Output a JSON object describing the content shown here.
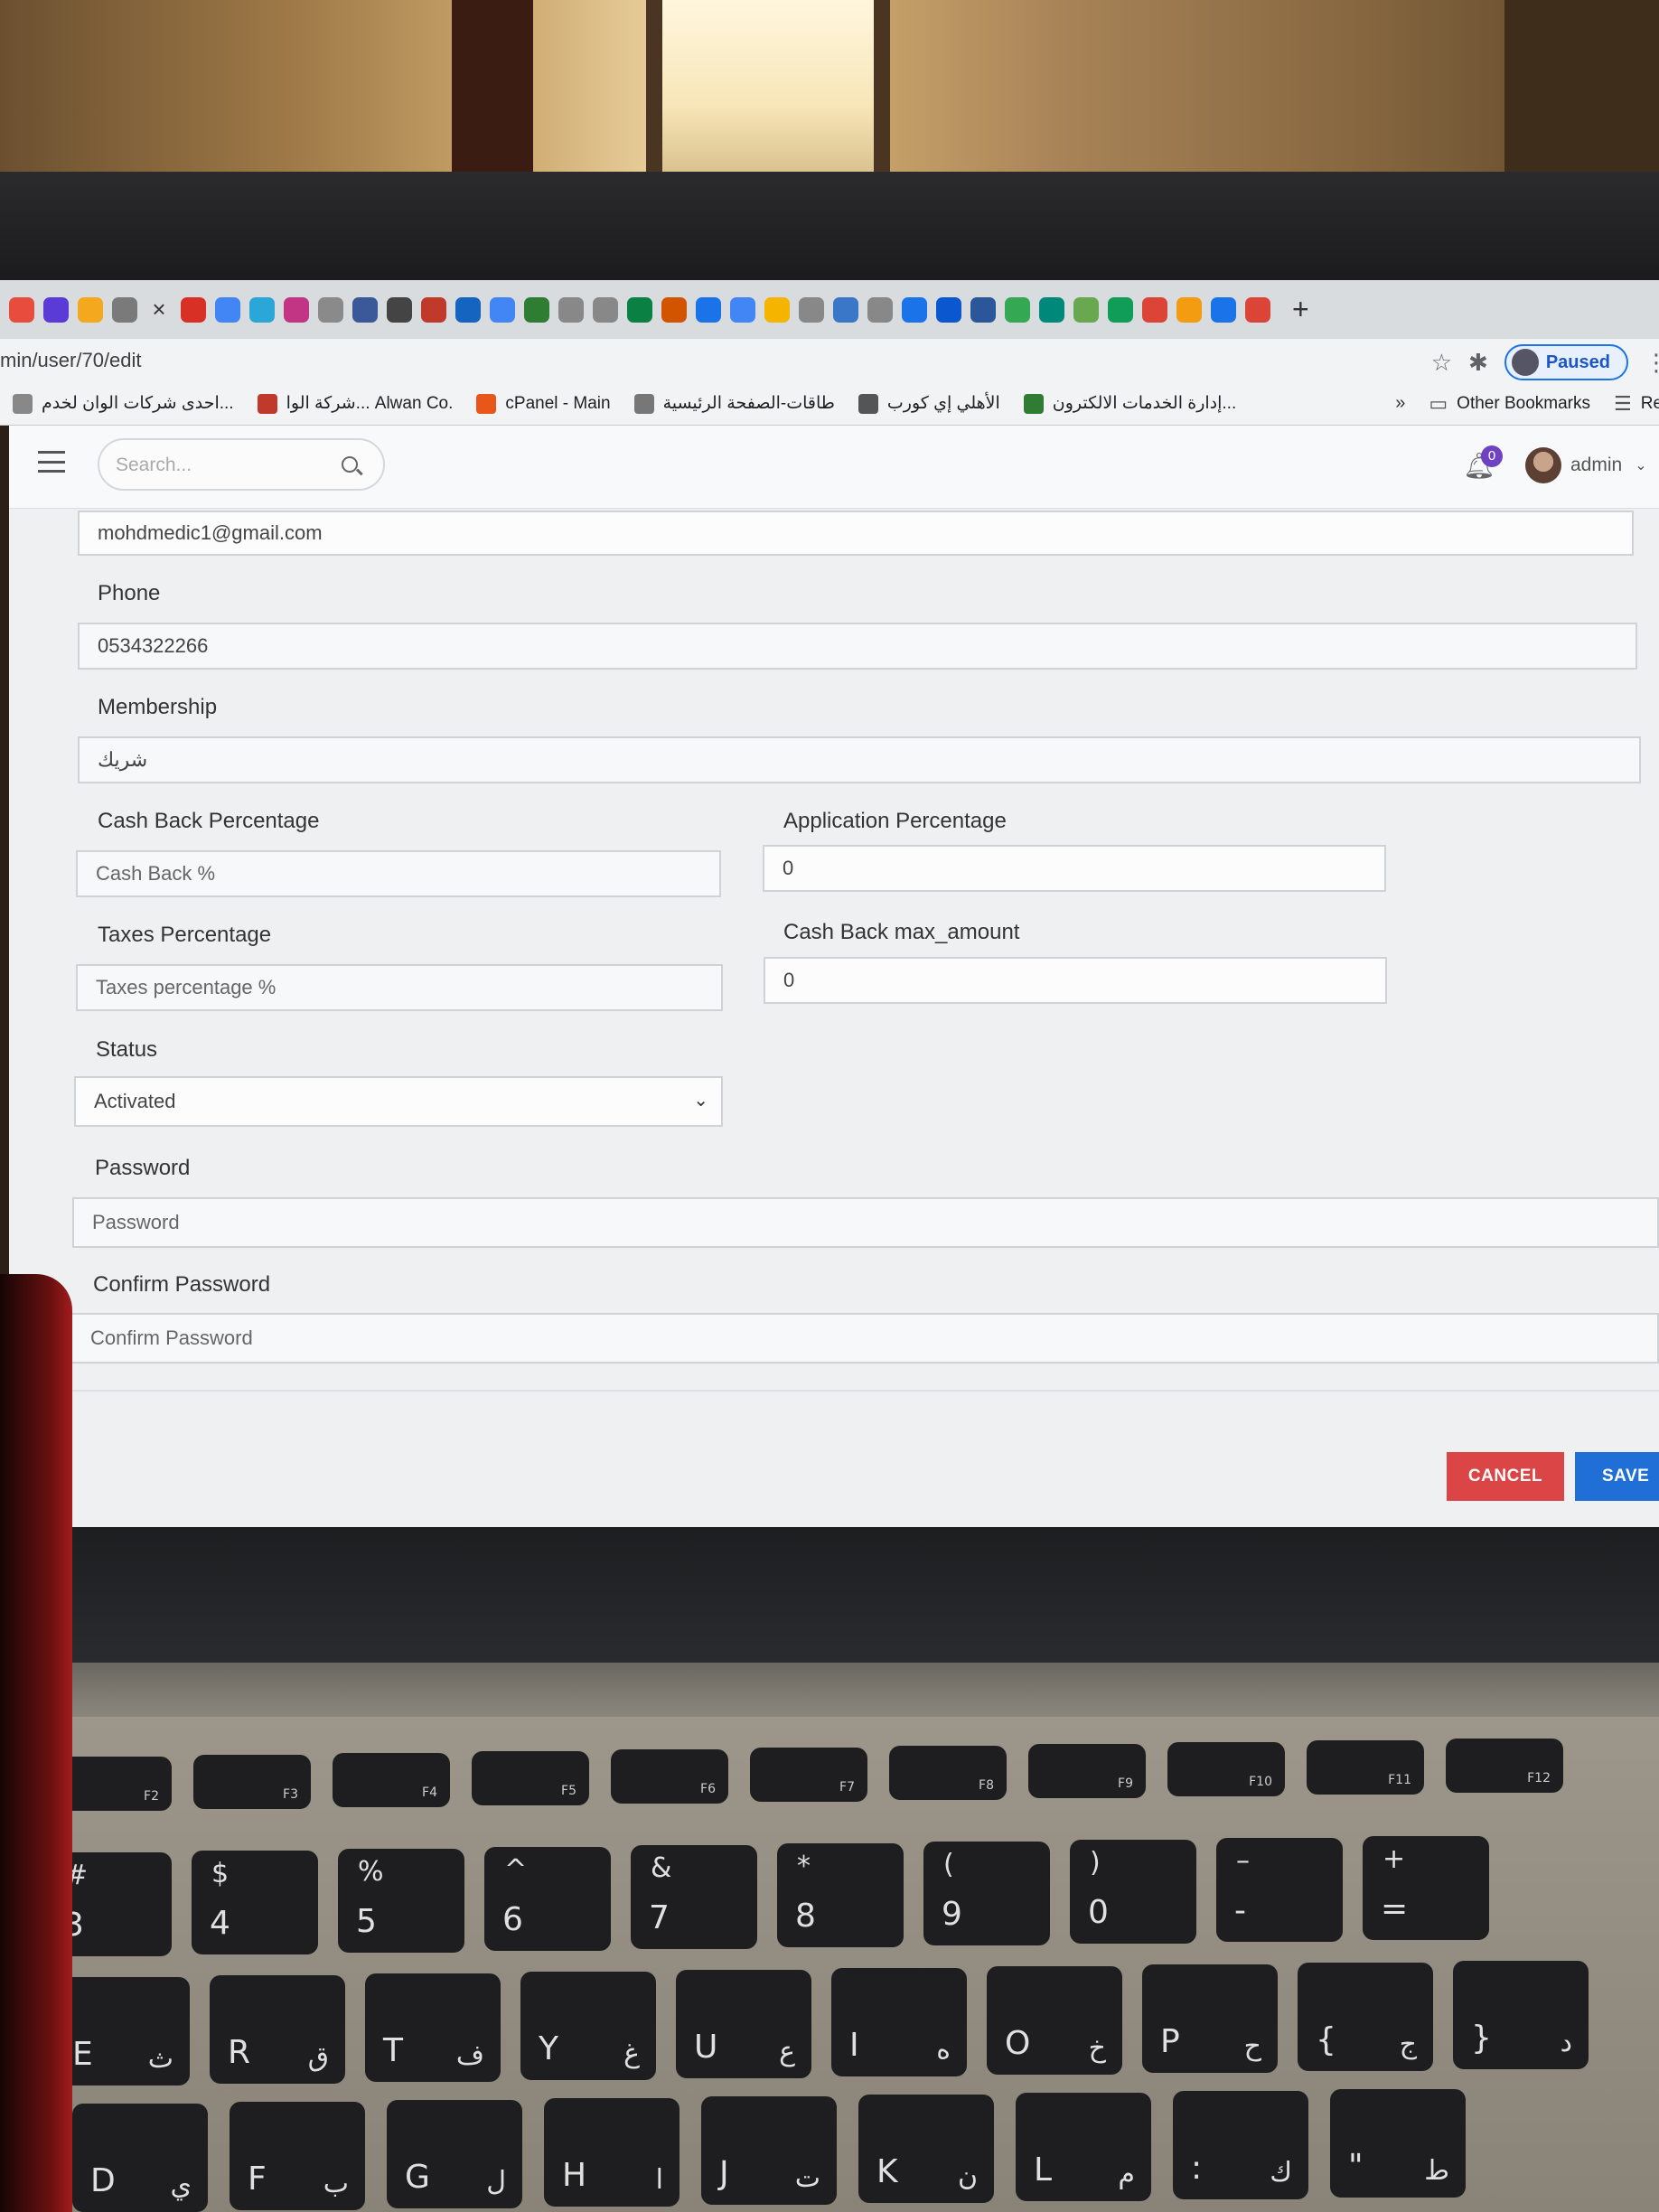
{
  "browser": {
    "tab_close_symbol": "×",
    "tab_new_symbol": "+",
    "url": "min/user/70/edit",
    "paused_label": "Paused",
    "tab_favicon_colors": [
      "#e84c3d",
      "#5b3bd6",
      "#f4a81d",
      "#7a7a7a",
      "#d93025",
      "#4285f4",
      "#2aa6d8",
      "#c13584",
      "#8a8a8a",
      "#3b5998",
      "#444",
      "#c0392b",
      "#1565c0",
      "#4285f4",
      "#2e7d32",
      "#888",
      "#888",
      "#0b8043",
      "#d35400",
      "#1a73e8",
      "#4285f4",
      "#f4b400",
      "#888",
      "#3b77c9",
      "#888",
      "#1a73e8",
      "#0b57d0",
      "#2b579a",
      "#34a853",
      "#00897b",
      "#6aa84f",
      "#0f9d58",
      "#db4437",
      "#f39c12",
      "#1a73e8",
      "#db4437"
    ]
  },
  "bookmarks": [
    {
      "label": "احدى شركات الوان لخدم...",
      "color": "#888"
    },
    {
      "label": "شركة الوا... Alwan Co.",
      "color": "#c0392b"
    },
    {
      "label": "cPanel - Main",
      "color": "#e8561a"
    },
    {
      "label": "طاقات-الصفحة الرئيسية",
      "color": "#777"
    },
    {
      "label": "الأهلي إي كورب",
      "color": "#555"
    },
    {
      "label": "إدارة الخدمات الالكترون...",
      "color": "#2e7d32"
    }
  ],
  "bookmarks_chevron": "»",
  "bookmarks_right": {
    "other": "Other Bookmarks",
    "reading": "Reading Lis"
  },
  "app_header": {
    "search_placeholder": "Search...",
    "notification_count": "0",
    "user_name": "admin"
  },
  "form": {
    "email_value": "mohdmedic1@gmail.com",
    "phone_label": "Phone",
    "phone_value": "0534322266",
    "membership_label": "Membership",
    "membership_value": "شريك",
    "cashback_label": "Cash Back Percentage",
    "cashback_placeholder": "Cash Back %",
    "application_label": "Application Percentage",
    "application_value": "0",
    "taxes_label": "Taxes Percentage",
    "taxes_placeholder": "Taxes percentage %",
    "cashback_max_label": "Cash Back max_amount",
    "cashback_max_value": "0",
    "status_label": "Status",
    "status_value": "Activated",
    "password_label": "Password",
    "password_placeholder": "Password",
    "confirm_label": "Confirm Password",
    "confirm_placeholder": "Confirm Password",
    "cancel_label": "CANCEL",
    "save_label": "SAVE"
  },
  "keyboard": {
    "fn_row": [
      {
        "fn": "F2"
      },
      {
        "fn": "F3"
      },
      {
        "fn": "F4"
      },
      {
        "fn": "F5"
      },
      {
        "fn": "F6"
      },
      {
        "fn": "F7"
      },
      {
        "fn": "F8"
      },
      {
        "fn": "F9"
      },
      {
        "fn": "F10"
      },
      {
        "fn": "F11"
      },
      {
        "fn": "F12"
      }
    ],
    "num_row": [
      {
        "top": "#",
        "main": "3"
      },
      {
        "top": "$",
        "main": "4"
      },
      {
        "top": "%",
        "main": "5"
      },
      {
        "top": "^",
        "main": "6"
      },
      {
        "top": "&",
        "main": "7"
      },
      {
        "top": "*",
        "main": "8"
      },
      {
        "top": "(",
        "main": "9"
      },
      {
        "top": ")",
        "main": "0"
      },
      {
        "top": "–",
        "main": "-"
      },
      {
        "top": "+",
        "main": "="
      }
    ],
    "q_row": [
      {
        "main": "E",
        "ar": "ث"
      },
      {
        "main": "R",
        "ar": "ق"
      },
      {
        "main": "T",
        "ar": "ف"
      },
      {
        "main": "Y",
        "ar": "غ"
      },
      {
        "main": "U",
        "ar": "ع"
      },
      {
        "main": "I",
        "ar": "ه"
      },
      {
        "main": "O",
        "ar": "خ"
      },
      {
        "main": "P",
        "ar": "ح"
      },
      {
        "main": "{",
        "ar": "ج"
      },
      {
        "main": "}",
        "ar": "د"
      }
    ],
    "a_row": [
      {
        "main": "D",
        "ar": "ي"
      },
      {
        "main": "F",
        "ar": "ب"
      },
      {
        "main": "G",
        "ar": "ل"
      },
      {
        "main": "H",
        "ar": "ا"
      },
      {
        "main": "J",
        "ar": "ت"
      },
      {
        "main": "K",
        "ar": "ن"
      },
      {
        "main": "L",
        "ar": "م"
      },
      {
        "main": ":",
        "ar": "ك"
      },
      {
        "main": "\"",
        "ar": "ط"
      }
    ]
  }
}
